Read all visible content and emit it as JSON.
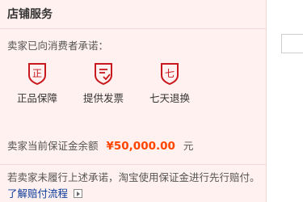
{
  "panel": {
    "title": "店铺服务"
  },
  "promise": {
    "intro": "卖家已向消费者承诺：",
    "badges": [
      {
        "label": "正品保障",
        "icon": "genuine-shield-icon",
        "glyph": "正"
      },
      {
        "label": "提供发票",
        "icon": "invoice-check-icon",
        "glyph": ""
      },
      {
        "label": "七天退换",
        "icon": "seven-day-return-icon",
        "glyph": "七"
      }
    ]
  },
  "deposit": {
    "label": "卖家当前保证金余额",
    "amount": "¥50,000.00",
    "unit": "元"
  },
  "compensation": {
    "text": "若卖家未履行上述承诺，淘宝使用保证金进行先行赔付。",
    "link": "了解赔付流程"
  },
  "colors": {
    "accent": "#ff4400",
    "shield": "#c8191f",
    "link": "#0a3a9a",
    "panel_bg": "#fff1ef"
  }
}
